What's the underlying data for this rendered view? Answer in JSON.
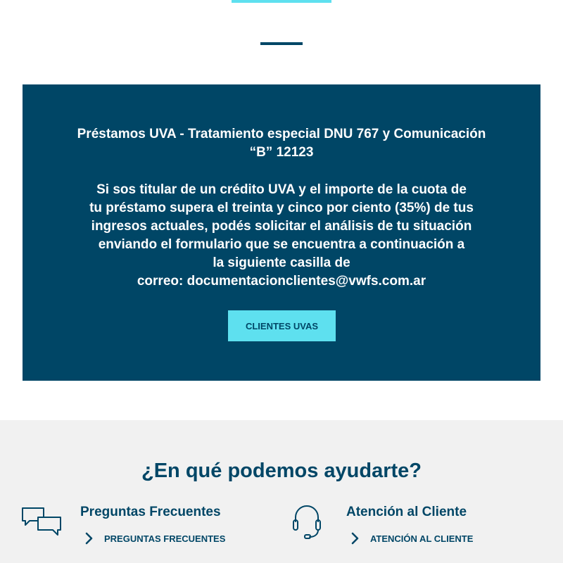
{
  "uva": {
    "title": "Préstamos UVA - Tratamiento especial DNU 767 y Comunicación “B” 12123",
    "body_lines": [
      "Si sos titular de un crédito UVA y el importe de la cuota de",
      "tu préstamo supera el treinta y cinco por ciento (35%) de tus",
      "ingresos actuales, podés solicitar el análisis de tu situación",
      "enviando el formulario que se encuentra a continuación a",
      "la siguiente casilla de",
      "correo: documentacionclientes@vwfs.com.ar"
    ],
    "button_label": "CLIENTES UVAS"
  },
  "help": {
    "title": "¿En qué podemos ayudarte?",
    "items": [
      {
        "icon": "chat-bubbles-icon",
        "heading": "Preguntas Frecuentes",
        "link_label": "PREGUNTAS FRECUENTES"
      },
      {
        "icon": "headset-icon",
        "heading": "Atención al Cliente",
        "link_label": "ATENCIÓN AL CLIENTE"
      }
    ]
  },
  "colors": {
    "primary": "#004666",
    "accent": "#5ee0ef",
    "section_bg": "#f1f1f1"
  }
}
